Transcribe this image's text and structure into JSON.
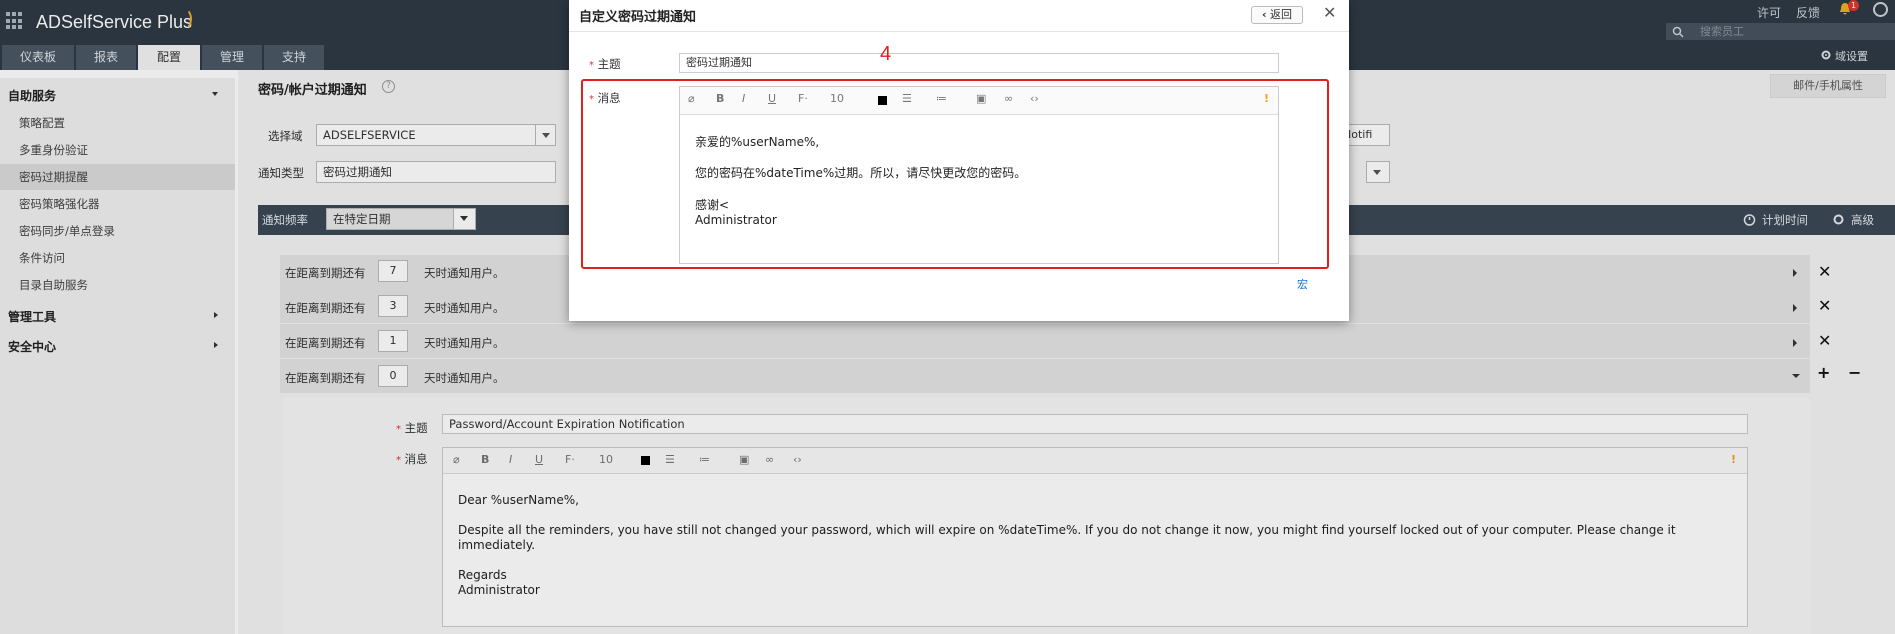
{
  "app": {
    "name": "ADSelfService Plus"
  },
  "tabs": [
    {
      "label": "仪表板"
    },
    {
      "label": "报表"
    },
    {
      "label": "配置"
    },
    {
      "label": "管理"
    },
    {
      "label": "支持"
    }
  ],
  "header": {
    "license": "许可",
    "feedback": "反馈",
    "notif_count": "1",
    "search_placeholder": "搜索员工",
    "domain_settings": "域设置"
  },
  "sidebar": {
    "group1": "自助服务",
    "items": [
      "策略配置",
      "多重身份验证",
      "密码过期提醒",
      "密码策略强化器",
      "密码同步/单点登录",
      "条件访问",
      "目录自助服务"
    ],
    "group2": "管理工具",
    "group3": "安全中心"
  },
  "page": {
    "title": "密码/帐户过期通知",
    "prop_button": "邮件/手机属性",
    "select_domain_label": "选择域",
    "select_domain_value": "ADSELFSERVICE",
    "notif_type_label": "通知类型",
    "notif_type_value": "密码过期通知",
    "notifi_partial": "Notifi"
  },
  "freq": {
    "label": "通知频率",
    "value": "在特定日期",
    "schedule": "计划时间",
    "advanced": "高级"
  },
  "rows": [
    {
      "prefix": "在距离到期还有",
      "days": "7",
      "suffix": "天时通知用户。"
    },
    {
      "prefix": "在距离到期还有",
      "days": "3",
      "suffix": "天时通知用户。"
    },
    {
      "prefix": "在距离到期还有",
      "days": "1",
      "suffix": "天时通知用户。"
    },
    {
      "prefix": "在距离到期还有",
      "days": "0",
      "suffix": "天时通知用户。"
    }
  ],
  "detail": {
    "subject_label": "主题",
    "subject_value": "Password/Account Expiration Notification",
    "message_label": "消息",
    "font_size": "10",
    "lines": [
      "Dear %userName%,",
      "Despite all the reminders, you have still not changed your password, which will expire on %dateTime%. If you do not change it now, you might find yourself locked out of your computer. Please change it",
      "immediately.",
      "Regards",
      "Administrator"
    ]
  },
  "modal": {
    "title": "自定义密码过期通知",
    "back": "返回",
    "subject_label": "主题",
    "subject_value": "密码过期通知",
    "message_label": "消息",
    "font_size": "10",
    "lines": [
      "亲爱的%userName%,",
      "您的密码在%dateTime%过期。所以，请尽快更改您的密码。",
      "感谢<",
      "Administrator"
    ],
    "macro": "宏",
    "annotation": "4"
  }
}
